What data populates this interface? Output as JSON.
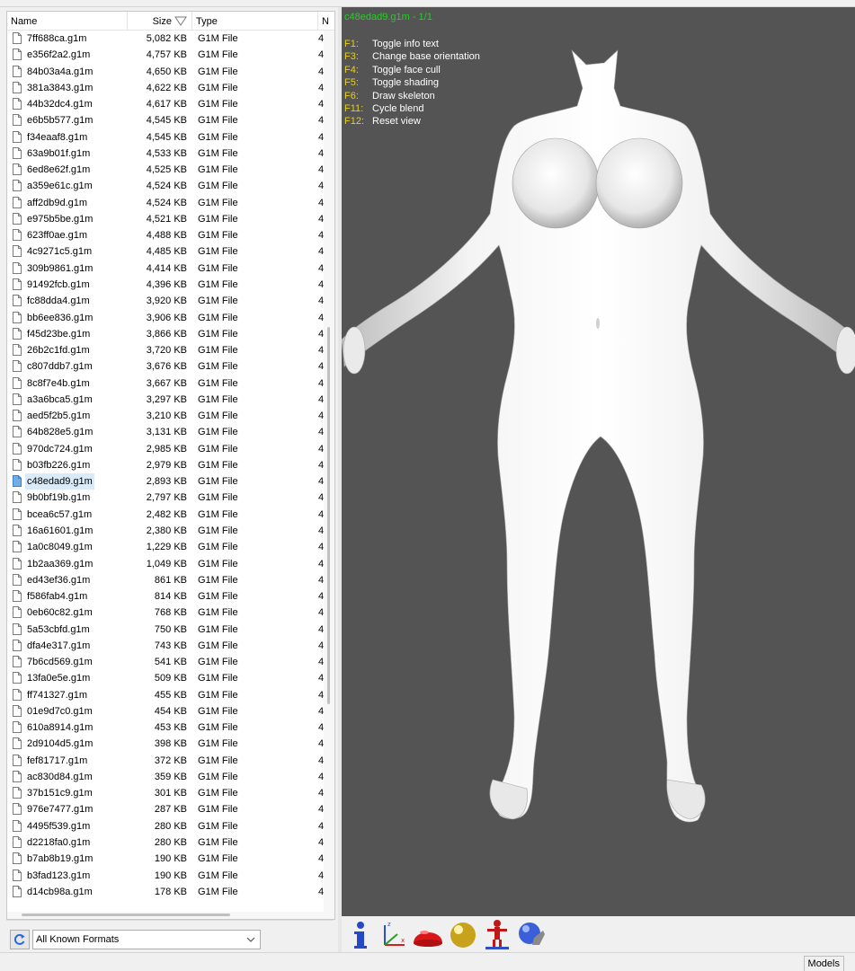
{
  "file_list": {
    "columns": {
      "name": "Name",
      "size": "Size",
      "type": "Type",
      "truncated": "N"
    },
    "rows": [
      {
        "name": "7ff688ca.g1m",
        "size": "5,082 KB",
        "type": "G1M File"
      },
      {
        "name": "e356f2a2.g1m",
        "size": "4,757 KB",
        "type": "G1M File"
      },
      {
        "name": "84b03a4a.g1m",
        "size": "4,650 KB",
        "type": "G1M File"
      },
      {
        "name": "381a3843.g1m",
        "size": "4,622 KB",
        "type": "G1M File"
      },
      {
        "name": "44b32dc4.g1m",
        "size": "4,617 KB",
        "type": "G1M File"
      },
      {
        "name": "e6b5b577.g1m",
        "size": "4,545 KB",
        "type": "G1M File"
      },
      {
        "name": "f34eaaf8.g1m",
        "size": "4,545 KB",
        "type": "G1M File"
      },
      {
        "name": "63a9b01f.g1m",
        "size": "4,533 KB",
        "type": "G1M File"
      },
      {
        "name": "6ed8e62f.g1m",
        "size": "4,525 KB",
        "type": "G1M File"
      },
      {
        "name": "a359e61c.g1m",
        "size": "4,524 KB",
        "type": "G1M File"
      },
      {
        "name": "aff2db9d.g1m",
        "size": "4,524 KB",
        "type": "G1M File"
      },
      {
        "name": "e975b5be.g1m",
        "size": "4,521 KB",
        "type": "G1M File"
      },
      {
        "name": "623ff0ae.g1m",
        "size": "4,488 KB",
        "type": "G1M File"
      },
      {
        "name": "4c9271c5.g1m",
        "size": "4,485 KB",
        "type": "G1M File"
      },
      {
        "name": "309b9861.g1m",
        "size": "4,414 KB",
        "type": "G1M File"
      },
      {
        "name": "91492fcb.g1m",
        "size": "4,396 KB",
        "type": "G1M File"
      },
      {
        "name": "fc88dda4.g1m",
        "size": "3,920 KB",
        "type": "G1M File"
      },
      {
        "name": "bb6ee836.g1m",
        "size": "3,906 KB",
        "type": "G1M File"
      },
      {
        "name": "f45d23be.g1m",
        "size": "3,866 KB",
        "type": "G1M File"
      },
      {
        "name": "26b2c1fd.g1m",
        "size": "3,720 KB",
        "type": "G1M File"
      },
      {
        "name": "c807ddb7.g1m",
        "size": "3,676 KB",
        "type": "G1M File"
      },
      {
        "name": "8c8f7e4b.g1m",
        "size": "3,667 KB",
        "type": "G1M File"
      },
      {
        "name": "a3a6bca5.g1m",
        "size": "3,297 KB",
        "type": "G1M File"
      },
      {
        "name": "aed5f2b5.g1m",
        "size": "3,210 KB",
        "type": "G1M File"
      },
      {
        "name": "64b828e5.g1m",
        "size": "3,131 KB",
        "type": "G1M File"
      },
      {
        "name": "970dc724.g1m",
        "size": "2,985 KB",
        "type": "G1M File"
      },
      {
        "name": "b03fb226.g1m",
        "size": "2,979 KB",
        "type": "G1M File"
      },
      {
        "name": "c48edad9.g1m",
        "size": "2,893 KB",
        "type": "G1M File",
        "selected": true
      },
      {
        "name": "9b0bf19b.g1m",
        "size": "2,797 KB",
        "type": "G1M File"
      },
      {
        "name": "bcea6c57.g1m",
        "size": "2,482 KB",
        "type": "G1M File"
      },
      {
        "name": "16a61601.g1m",
        "size": "2,380 KB",
        "type": "G1M File"
      },
      {
        "name": "1a0c8049.g1m",
        "size": "1,229 KB",
        "type": "G1M File"
      },
      {
        "name": "1b2aa369.g1m",
        "size": "1,049 KB",
        "type": "G1M File"
      },
      {
        "name": "ed43ef36.g1m",
        "size": "861 KB",
        "type": "G1M File"
      },
      {
        "name": "f586fab4.g1m",
        "size": "814 KB",
        "type": "G1M File"
      },
      {
        "name": "0eb60c82.g1m",
        "size": "768 KB",
        "type": "G1M File"
      },
      {
        "name": "5a53cbfd.g1m",
        "size": "750 KB",
        "type": "G1M File"
      },
      {
        "name": "dfa4e317.g1m",
        "size": "743 KB",
        "type": "G1M File"
      },
      {
        "name": "7b6cd569.g1m",
        "size": "541 KB",
        "type": "G1M File"
      },
      {
        "name": "13fa0e5e.g1m",
        "size": "509 KB",
        "type": "G1M File"
      },
      {
        "name": "ff741327.g1m",
        "size": "455 KB",
        "type": "G1M File"
      },
      {
        "name": "01e9d7c0.g1m",
        "size": "454 KB",
        "type": "G1M File"
      },
      {
        "name": "610a8914.g1m",
        "size": "453 KB",
        "type": "G1M File"
      },
      {
        "name": "2d9104d5.g1m",
        "size": "398 KB",
        "type": "G1M File"
      },
      {
        "name": "fef81717.g1m",
        "size": "372 KB",
        "type": "G1M File"
      },
      {
        "name": "ac830d84.g1m",
        "size": "359 KB",
        "type": "G1M File"
      },
      {
        "name": "37b151c9.g1m",
        "size": "301 KB",
        "type": "G1M File"
      },
      {
        "name": "976e7477.g1m",
        "size": "287 KB",
        "type": "G1M File"
      },
      {
        "name": "4495f539.g1m",
        "size": "280 KB",
        "type": "G1M File"
      },
      {
        "name": "d2218fa0.g1m",
        "size": "280 KB",
        "type": "G1M File"
      },
      {
        "name": "b7ab8b19.g1m",
        "size": "190 KB",
        "type": "G1M File"
      },
      {
        "name": "b3fad123.g1m",
        "size": "190 KB",
        "type": "G1M File"
      },
      {
        "name": "d14cb98a.g1m",
        "size": "178 KB",
        "type": "G1M File"
      }
    ],
    "truncated_cell": "4"
  },
  "filter": {
    "value": "All Known Formats"
  },
  "viewport": {
    "title": "c48edad9.g1m - 1/1",
    "help": [
      {
        "key": "F1:",
        "label": "Toggle info text"
      },
      {
        "key": "F3:",
        "label": "Change base orientation"
      },
      {
        "key": "F4:",
        "label": "Toggle face cull"
      },
      {
        "key": "F5:",
        "label": "Toggle shading"
      },
      {
        "key": "F6:",
        "label": "Draw skeleton"
      },
      {
        "key": "F11:",
        "label": "Cycle blend"
      },
      {
        "key": "F12:",
        "label": "Reset view"
      }
    ]
  },
  "toolbar": {
    "icons": [
      "info-icon",
      "axes-icon",
      "dome-icon",
      "sphere-icon",
      "skeleton-icon",
      "globe-hand-icon"
    ]
  },
  "status": {
    "tab": "Models"
  },
  "colors": {
    "viewport_bg": "#545454",
    "title_green": "#1cd41c",
    "key_yellow": "#e8d01c",
    "selection": "#d9ebf9"
  }
}
